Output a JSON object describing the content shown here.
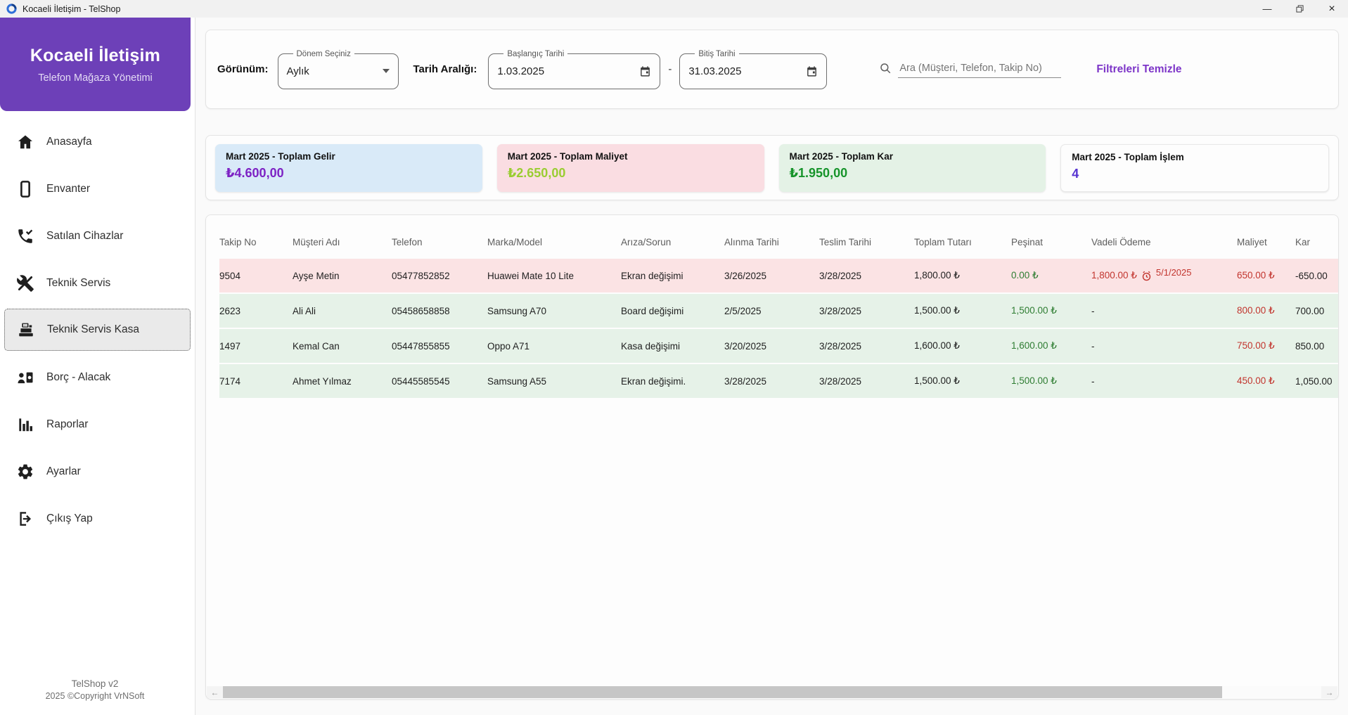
{
  "window": {
    "title": "Kocaeli İletişim - TelShop",
    "controls": {
      "minimize": "—",
      "close": "×"
    }
  },
  "sidebar": {
    "brand_title": "Kocaeli İletişim",
    "brand_subtitle": "Telefon Mağaza Yönetimi",
    "items": [
      {
        "label": "Anasayfa",
        "icon": "home-icon"
      },
      {
        "label": "Envanter",
        "icon": "smartphone-icon"
      },
      {
        "label": "Satılan Cihazlar",
        "icon": "phone-check-icon"
      },
      {
        "label": "Teknik Servis",
        "icon": "tools-icon"
      },
      {
        "label": "Teknik Servis Kasa",
        "icon": "cash-register-icon",
        "selected": true
      },
      {
        "label": "Borç - Alacak",
        "icon": "person-banknote-icon"
      },
      {
        "label": "Raporlar",
        "icon": "bar-chart-icon"
      },
      {
        "label": "Ayarlar",
        "icon": "gear-icon"
      },
      {
        "label": "Çıkış Yap",
        "icon": "logout-icon"
      }
    ],
    "footer_line1": "TelShop v2",
    "footer_line2": "2025 ©Copyright VrNSoft"
  },
  "filters": {
    "view_label": "Görünüm:",
    "period_field_label": "Dönem Seçiniz",
    "period_value": "Aylık",
    "date_range_label": "Tarih Aralığı:",
    "start_field_label": "Başlangıç Tarihi",
    "start_value": "1.03.2025",
    "range_separator": "-",
    "end_field_label": "Bitiş Tarihi",
    "end_value": "31.03.2025",
    "search_placeholder": "Ara (Müşteri, Telefon, Takip No)",
    "clear_filters_label": "Filtreleri Temizle"
  },
  "summary_cards": [
    {
      "title": "Mart 2025 - Toplam Gelir",
      "value": "₺4.600,00",
      "bg_color": "#d9eaf8",
      "value_color": "#7d22c4"
    },
    {
      "title": "Mart 2025 - Toplam Maliyet",
      "value": "₺2.650,00",
      "bg_color": "#fadde2",
      "value_color": "#9acd32"
    },
    {
      "title": "Mart 2025 - Toplam Kar",
      "value": "₺1.950,00",
      "bg_color": "#e4f2e6",
      "value_color": "#17942b"
    },
    {
      "title": "Mart 2025 - Toplam İşlem",
      "value": "4",
      "bg_color": "#fdfdfd",
      "value_color": "#5633d1"
    }
  ],
  "table": {
    "columns": [
      "Takip No",
      "Müşteri Adı",
      "Telefon",
      "Marka/Model",
      "Arıza/Sorun",
      "Alınma Tarihi",
      "Teslim Tarihi",
      "Toplam Tutarı",
      "Peşinat",
      "Vadeli Ödeme",
      "Maliyet",
      "Kar"
    ],
    "rows": [
      {
        "takip_no": "9504",
        "musteri_adi": "Ayşe Metin",
        "telefon": "05477852852",
        "marka_model": "Huawei Mate 10 Lite",
        "ariza_sorun": "Ekran değişimi",
        "alinma_tarihi": "3/26/2025",
        "teslim_tarihi": "3/28/2025",
        "toplam_tutari": "1,800.00 ₺",
        "pesinat": "0.00 ₺",
        "vadeli_odeme": "1,800.00 ₺",
        "vadeli_tarih": "5/1/2025",
        "maliyet": "650.00 ₺",
        "kar": "-650.00"
      },
      {
        "takip_no": "2623",
        "musteri_adi": "Ali Ali",
        "telefon": "05458658858",
        "marka_model": "Samsung A70",
        "ariza_sorun": "Board değişimi",
        "alinma_tarihi": "2/5/2025",
        "teslim_tarihi": "3/28/2025",
        "toplam_tutari": "1,500.00 ₺",
        "pesinat": "1,500.00 ₺",
        "vadeli_odeme": "-",
        "maliyet": "800.00 ₺",
        "kar": "700.00"
      },
      {
        "takip_no": "1497",
        "musteri_adi": "Kemal Can",
        "telefon": "05447855855",
        "marka_model": "Oppo A71",
        "ariza_sorun": "Kasa değişimi",
        "alinma_tarihi": "3/20/2025",
        "teslim_tarihi": "3/28/2025",
        "toplam_tutari": "1,600.00 ₺",
        "pesinat": "1,600.00 ₺",
        "vadeli_odeme": "-",
        "maliyet": "750.00 ₺",
        "kar": "850.00"
      },
      {
        "takip_no": "7174",
        "musteri_adi": "Ahmet Yılmaz",
        "telefon": "05445585545",
        "marka_model": "Samsung A55",
        "ariza_sorun": "Ekran değişimi.",
        "alinma_tarihi": "3/28/2025",
        "teslim_tarihi": "3/28/2025",
        "toplam_tutari": "1,500.00 ₺",
        "pesinat": "1,500.00 ₺",
        "vadeli_odeme": "-",
        "maliyet": "450.00 ₺",
        "kar": "1,050.00"
      }
    ]
  },
  "scrollbar": {
    "left_arrow": "←",
    "right_arrow": "→"
  }
}
